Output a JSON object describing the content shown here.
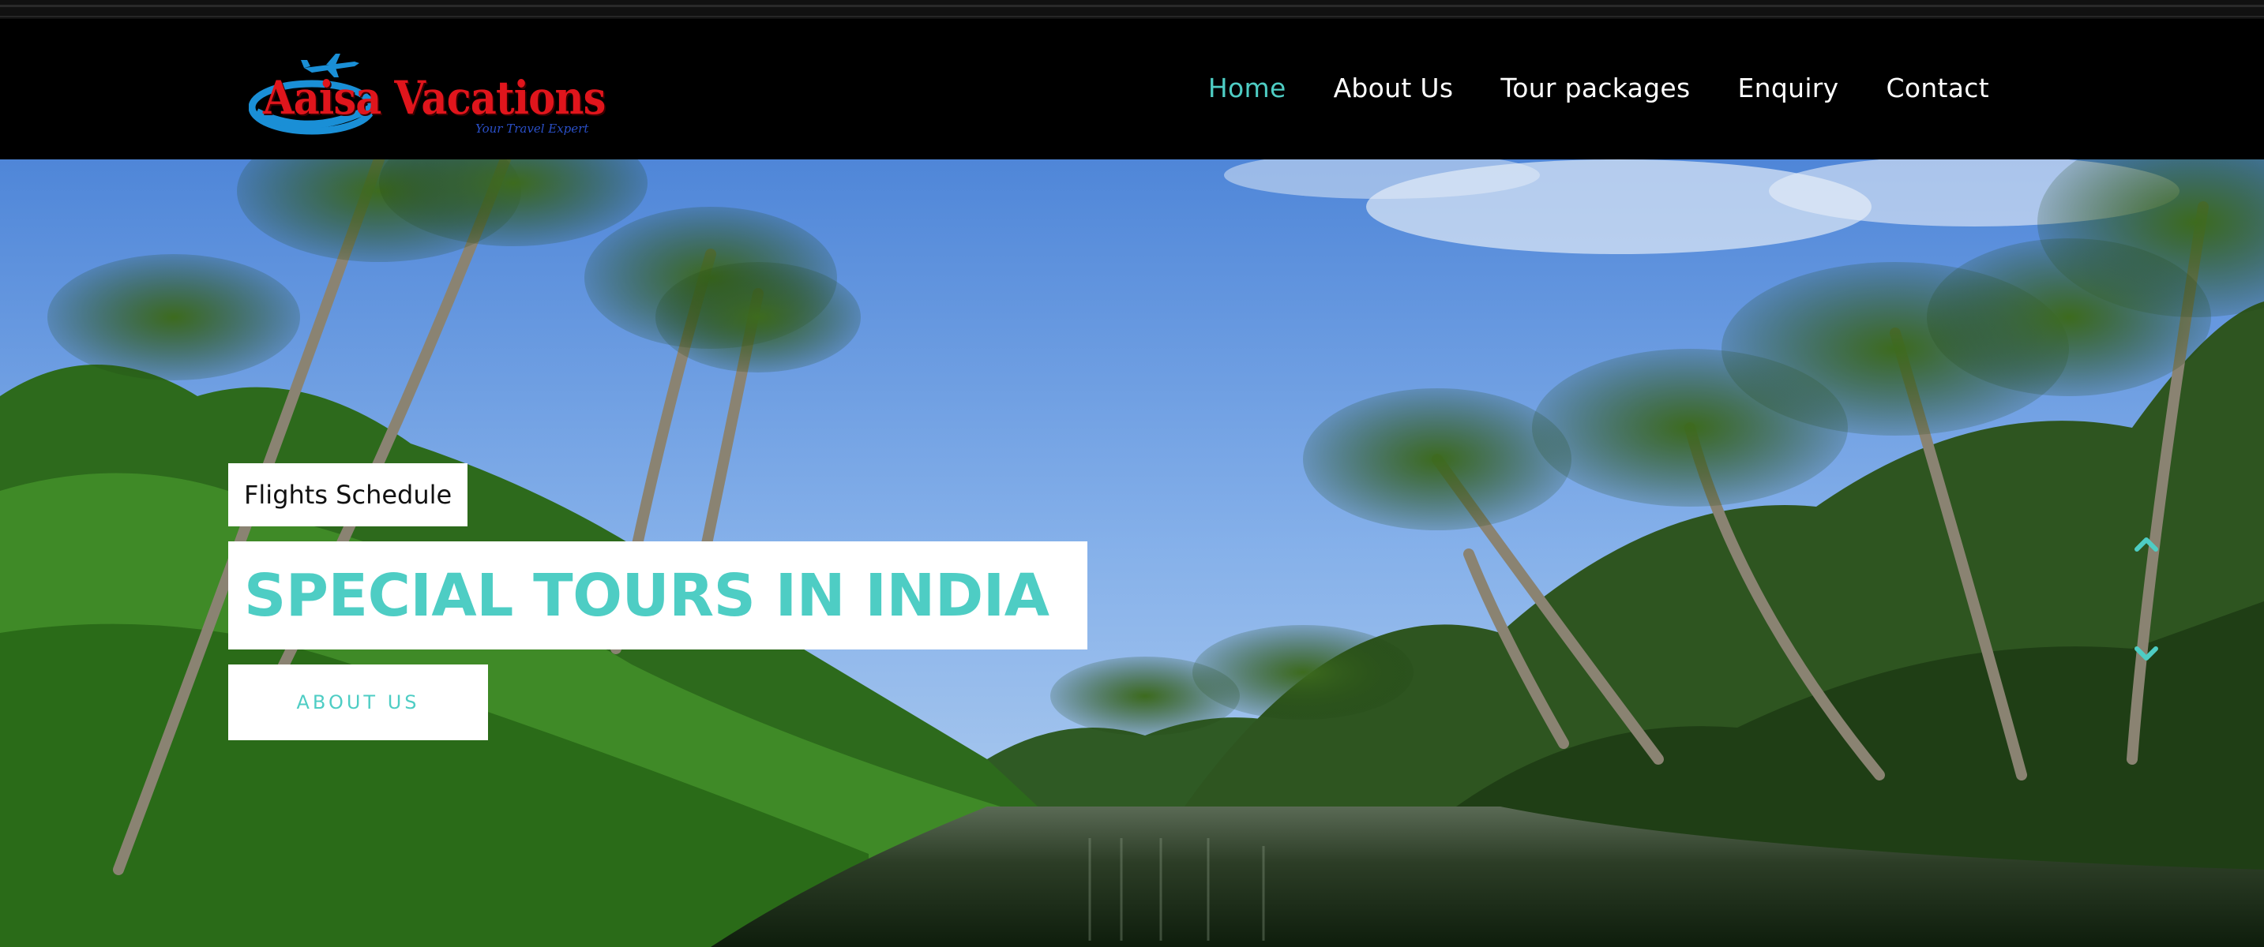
{
  "brand": {
    "name": "Aaisa Vacations",
    "tagline": "Your Travel Expert",
    "primary_color": "#e0151c",
    "swoosh_color": "#1a8fd6"
  },
  "nav": {
    "items": [
      {
        "label": "Home",
        "active": true
      },
      {
        "label": "About Us",
        "active": false
      },
      {
        "label": "Tour packages",
        "active": false
      },
      {
        "label": "Enquiry",
        "active": false
      },
      {
        "label": "Contact",
        "active": false
      }
    ],
    "active_color": "#4ecdc4"
  },
  "hero": {
    "badge": "Flights Schedule",
    "title": "SPECIAL TOURS IN INDIA",
    "button_label": "ABOUT US",
    "accent_color": "#4ecdc4",
    "image_subject": "backwater-palm-trees",
    "prev_icon": "chevron-up-icon",
    "next_icon": "chevron-down-icon"
  }
}
